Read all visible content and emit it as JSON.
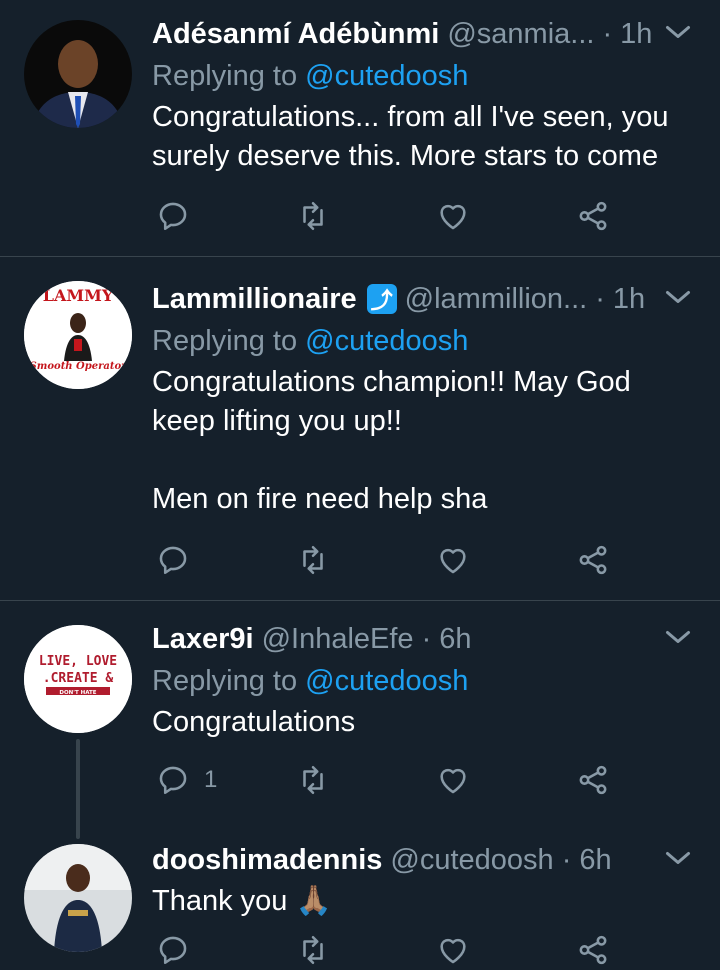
{
  "colors": {
    "background": "#15202b",
    "accent": "#1da1f2",
    "muted": "#8899a6",
    "divider": "#38444d"
  },
  "tweets": [
    {
      "name": "Adésanmí Adébùnmi",
      "handle": "@sanmia...",
      "time": "· 1h",
      "replying_prefix": "Replying to ",
      "replying_to": "@cutedoosh",
      "text_lines": [
        "Congratulations... from all I've seen, you",
        "surely deserve this. More stars to come"
      ],
      "reply_count": ""
    },
    {
      "name": "Lammillionaire",
      "verified_icon": "up-arrow-badge-icon",
      "handle": "@lammillion...",
      "time": "· 1h",
      "replying_prefix": "Replying to ",
      "replying_to": "@cutedoosh",
      "text_lines": [
        "Congratulations champion!! May God",
        "keep lifting you up!!",
        "",
        "Men on fire need help sha"
      ],
      "avatar_text": {
        "top": "LAMMY",
        "bottom": "Smooth Operator"
      },
      "reply_count": ""
    },
    {
      "name": "Laxer9i",
      "handle": "@InhaleEfe",
      "time": "· 6h",
      "replying_prefix": "Replying to ",
      "replying_to": "@cutedoosh",
      "text_lines": [
        "Congratulations"
      ],
      "avatar_text": {
        "line1": "LIVE, LOVE",
        "line2": ".CREATE &",
        "line3": "DON'T HATE"
      },
      "reply_count": "1"
    },
    {
      "name": "dooshimadennis",
      "handle": "@cutedoosh",
      "time": "· 6h",
      "text_lines": [
        "Thank you 🙏🏽"
      ],
      "reply_count": ""
    }
  ]
}
